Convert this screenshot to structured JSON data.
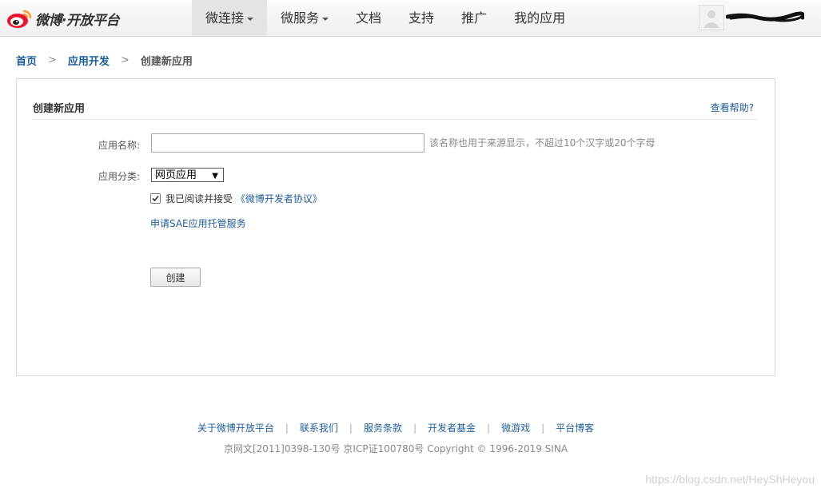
{
  "header": {
    "logo_text": "微博·开放平台",
    "nav": [
      {
        "label": "微连接",
        "dropdown": true,
        "active": true
      },
      {
        "label": "微服务",
        "dropdown": true,
        "active": false
      },
      {
        "label": "文档",
        "dropdown": false,
        "active": false
      },
      {
        "label": "支持",
        "dropdown": false,
        "active": false
      },
      {
        "label": "推广",
        "dropdown": false,
        "active": false
      },
      {
        "label": "我的应用",
        "dropdown": false,
        "active": false
      }
    ],
    "user_icon": "default-avatar-icon"
  },
  "breadcrumb": {
    "items": [
      "首页",
      "应用开发"
    ],
    "current": "创建新应用",
    "separator": ">"
  },
  "panel": {
    "title": "创建新应用",
    "help_link": "查看帮助?",
    "name_label": "应用名称:",
    "name_value": "",
    "name_hint": "该名称也用于来源显示，不超过10个汉字或20个字母",
    "category_label": "应用分类:",
    "category_selected": "网页应用",
    "agree_checked": true,
    "agree_text": "我已阅读并接受",
    "agree_link": "《微博开发者协议》",
    "sae_link": "申请SAE应用托管服务",
    "create_button": "创建"
  },
  "footer": {
    "links": [
      "关于微博开放平台",
      "联系我们",
      "服务条款",
      "开发者基金",
      "微游戏",
      "平台博客"
    ],
    "separator": "|",
    "copyright": "京网文[2011]0398-130号 京ICP证100780号 Copyright © 1996-2019 SINA"
  },
  "watermark": "https://blog.csdn.net/HeyShHeyou",
  "colors": {
    "link": "#1f5d97",
    "header_bg": "#f5f5f5",
    "active_nav_bg": "#e4e4e4",
    "weibo_red": "#e6162d",
    "weibo_orange": "#ff9933"
  }
}
